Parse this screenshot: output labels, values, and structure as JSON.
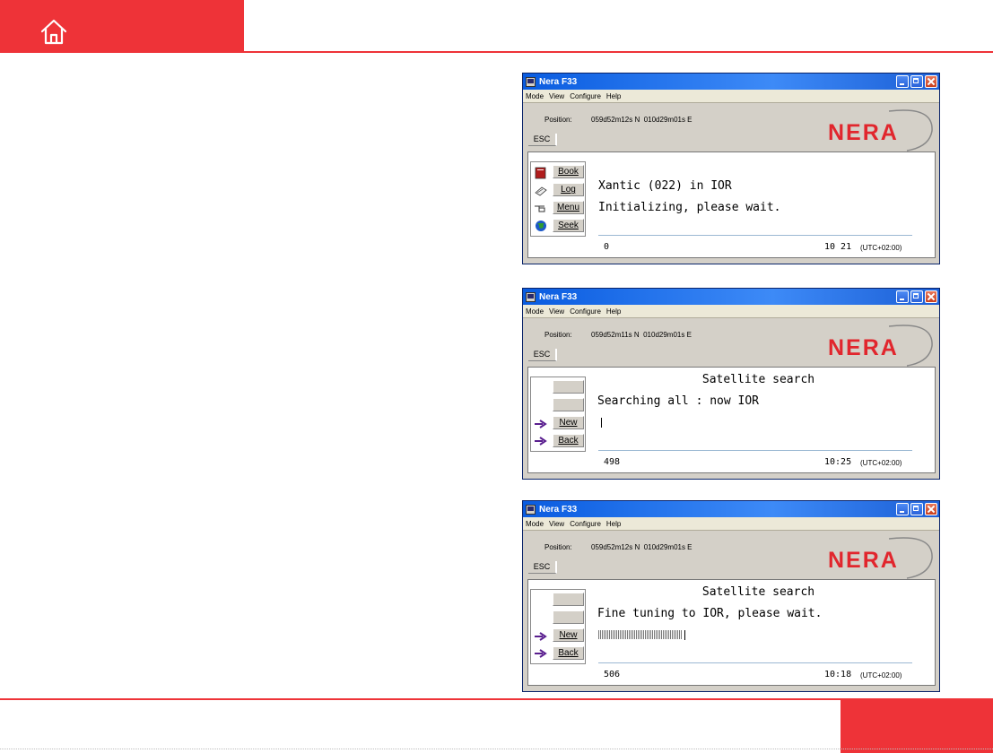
{
  "colors": {
    "accent": "#ee3338",
    "title_bar": "#0a5ce0",
    "window_bg": "#d4d0c8"
  },
  "header": {
    "home_icon": "home-icon"
  },
  "windows": [
    {
      "title": "Nera F33",
      "menu": [
        "Mode",
        "View",
        "Configure",
        "Help"
      ],
      "position_label": "Position:",
      "position_value": "059d52m12s N  010d29m01s E",
      "esc_label": "ESC",
      "logo_text": "NERA",
      "buttons": [
        {
          "label": "Book",
          "icon": "book-icon"
        },
        {
          "label": "Log",
          "icon": "log-icon"
        },
        {
          "label": "Menu",
          "icon": "hand-pointer-icon"
        },
        {
          "label": "Seek",
          "icon": "globe-icon"
        }
      ],
      "line1": "Xantic (022) in IOR",
      "line2": "Initializing, please wait.",
      "status_left": "0",
      "status_time": "10 21",
      "status_tz": "(UTC+02:00)"
    },
    {
      "title": "Nera F33",
      "menu": [
        "Mode",
        "View",
        "Configure",
        "Help"
      ],
      "position_label": "Position:",
      "position_value": "059d52m11s N  010d29m01s E",
      "esc_label": "ESC",
      "logo_text": "NERA",
      "buttons": [
        {
          "label": "",
          "icon": ""
        },
        {
          "label": "",
          "icon": ""
        },
        {
          "label": "New",
          "icon": "arrow-right-icon"
        },
        {
          "label": "Back",
          "icon": "arrow-right-icon"
        }
      ],
      "heading": "Satellite search",
      "line1": "Searching all : now IOR",
      "progress": 0.0,
      "status_left": "498",
      "status_time": "10:25",
      "status_tz": "(UTC+02:00)"
    },
    {
      "title": "Nera F33",
      "menu": [
        "Mode",
        "View",
        "Configure",
        "Help"
      ],
      "position_label": "Position:",
      "position_value": "059d52m12s N  010d29m01s E",
      "esc_label": "ESC",
      "logo_text": "NERA",
      "buttons": [
        {
          "label": "",
          "icon": ""
        },
        {
          "label": "",
          "icon": ""
        },
        {
          "label": "New",
          "icon": "arrow-right-icon"
        },
        {
          "label": "Back",
          "icon": "arrow-right-icon"
        }
      ],
      "heading": "Satellite search",
      "line1": "Fine tuning to IOR, please wait.",
      "progress": 0.47,
      "status_left": "506",
      "status_time": "10:18",
      "status_tz": "(UTC+02:00)"
    }
  ]
}
